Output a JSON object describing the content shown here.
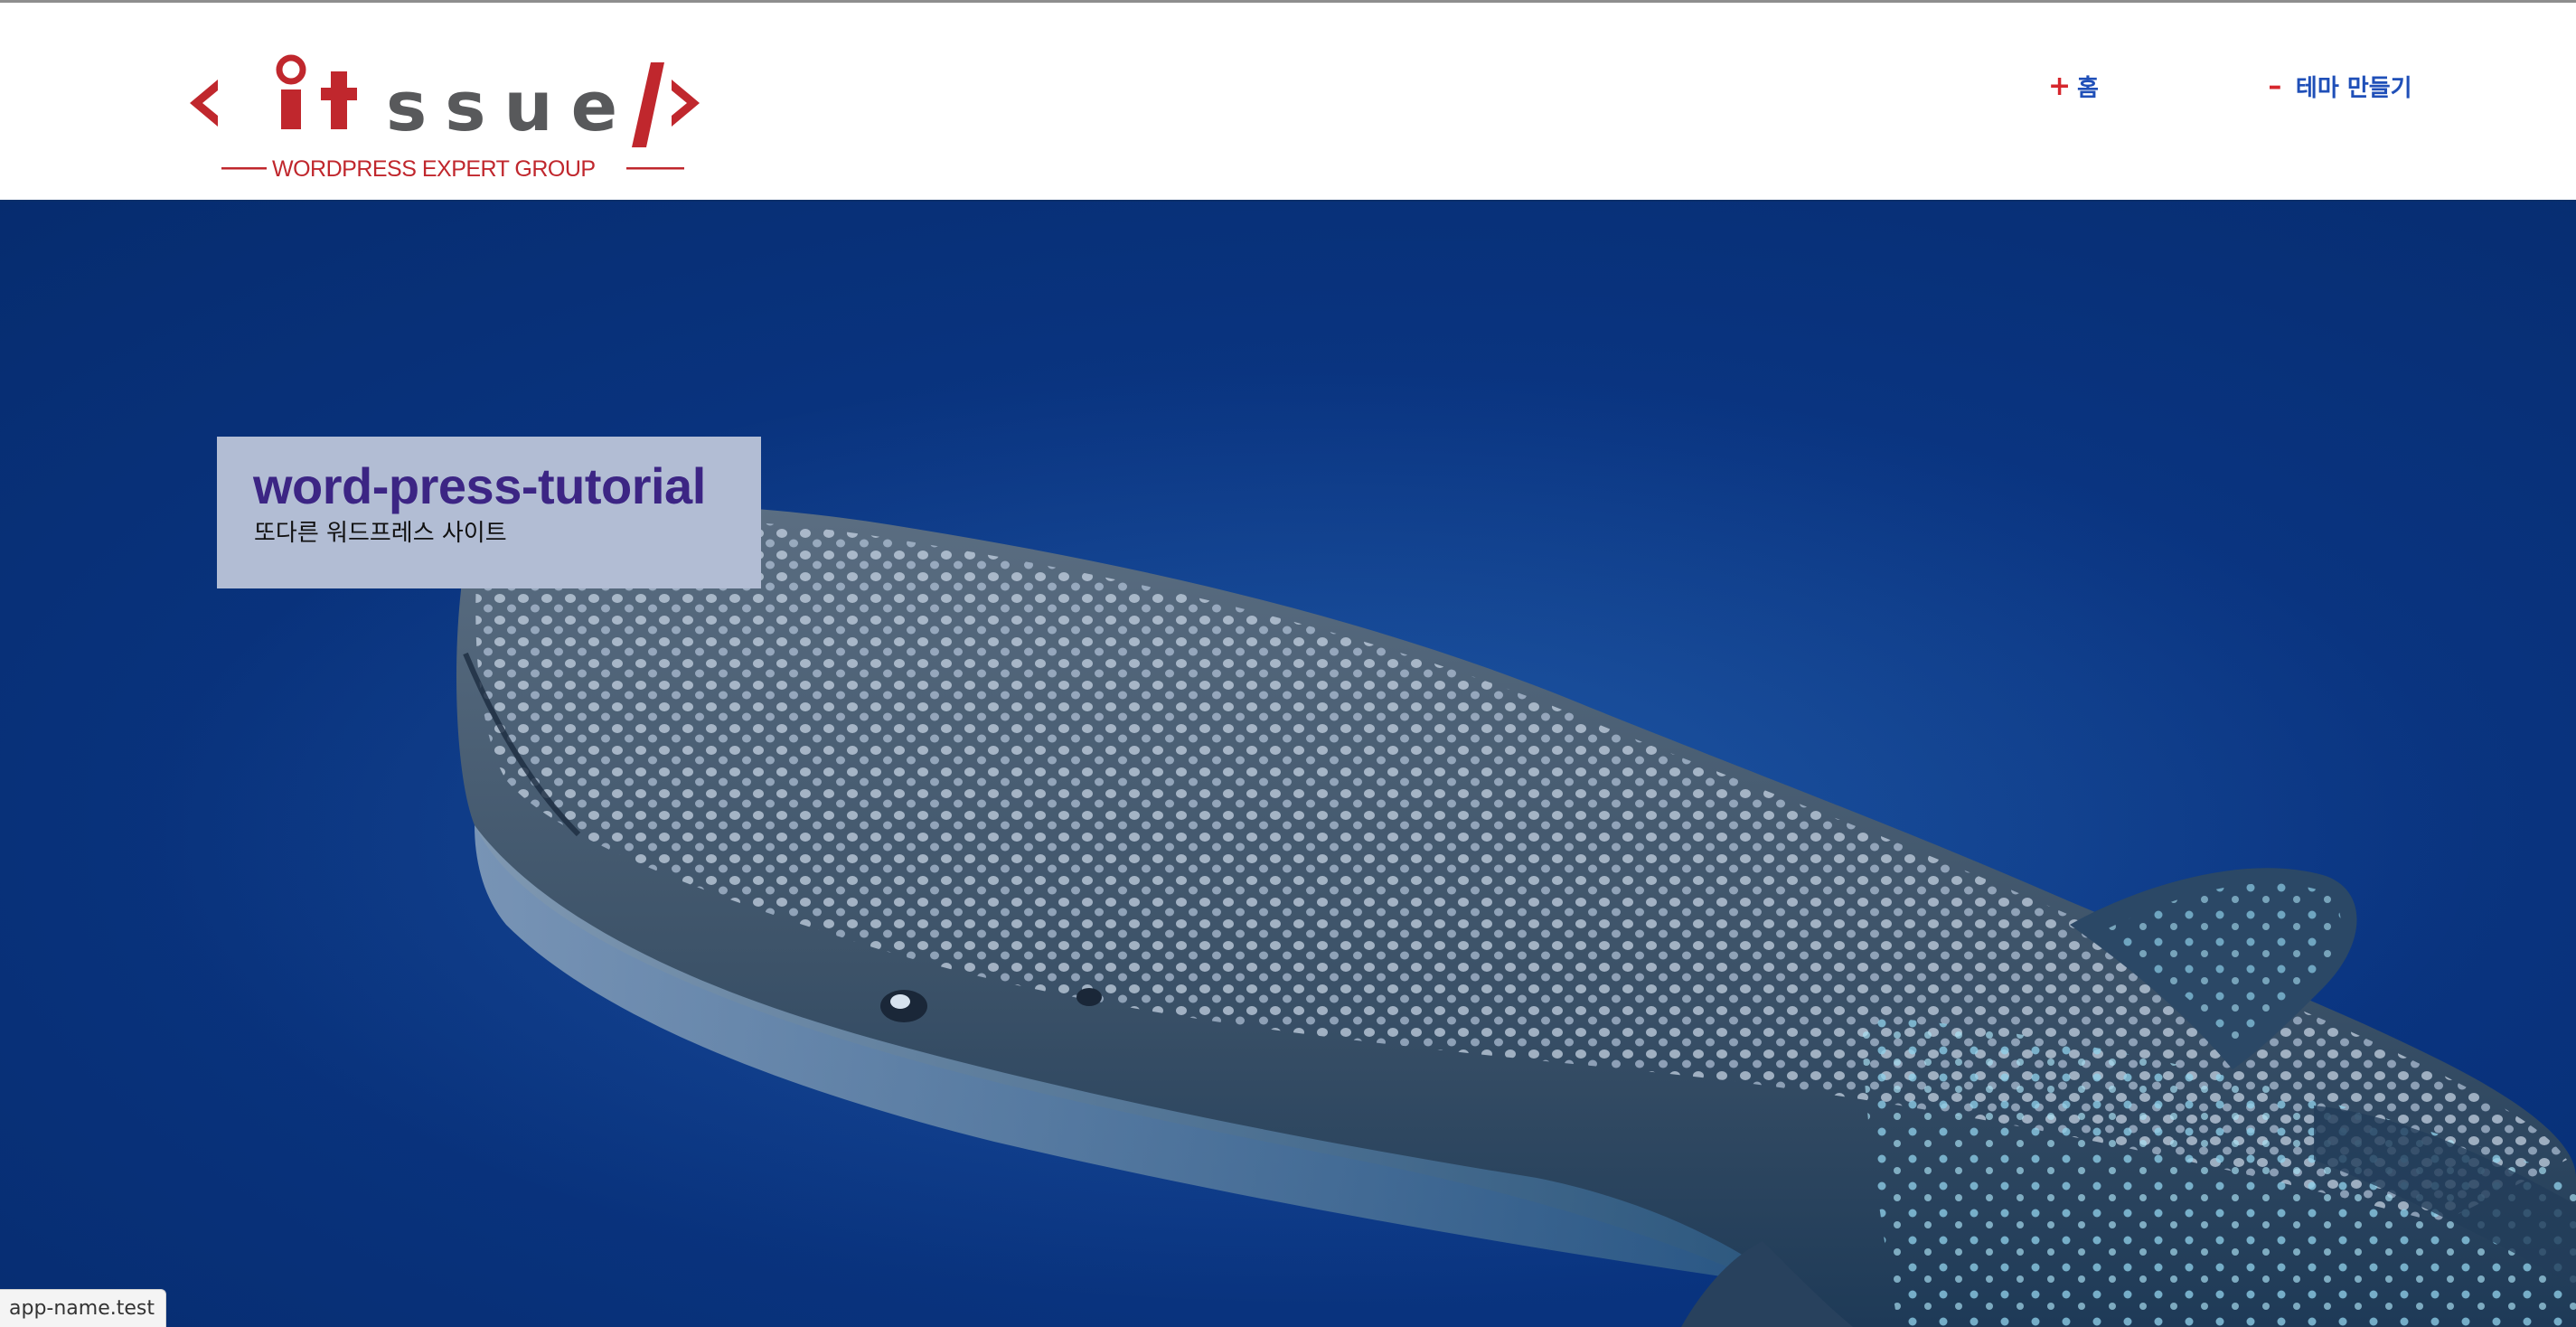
{
  "brand": {
    "logo_text": "itssue",
    "logo_tagline": "WORDPRESS EXPERT GROUP",
    "logo_color": "#c0272d",
    "logo_text_color": "#58595b"
  },
  "nav": {
    "items": [
      {
        "sign": "+",
        "label": "홈"
      },
      {
        "sign": "–",
        "label": "테마 만들기"
      }
    ],
    "link_color": "#1f4fb8",
    "sign_color": "#d6262c"
  },
  "hero": {
    "site_title": "word-press-tutorial",
    "site_tagline": "또다른 워드프레스 사이트",
    "image": "whale-shark-photo",
    "background_color": "#0a3582"
  },
  "status_bar": {
    "url": "app-name.test"
  }
}
